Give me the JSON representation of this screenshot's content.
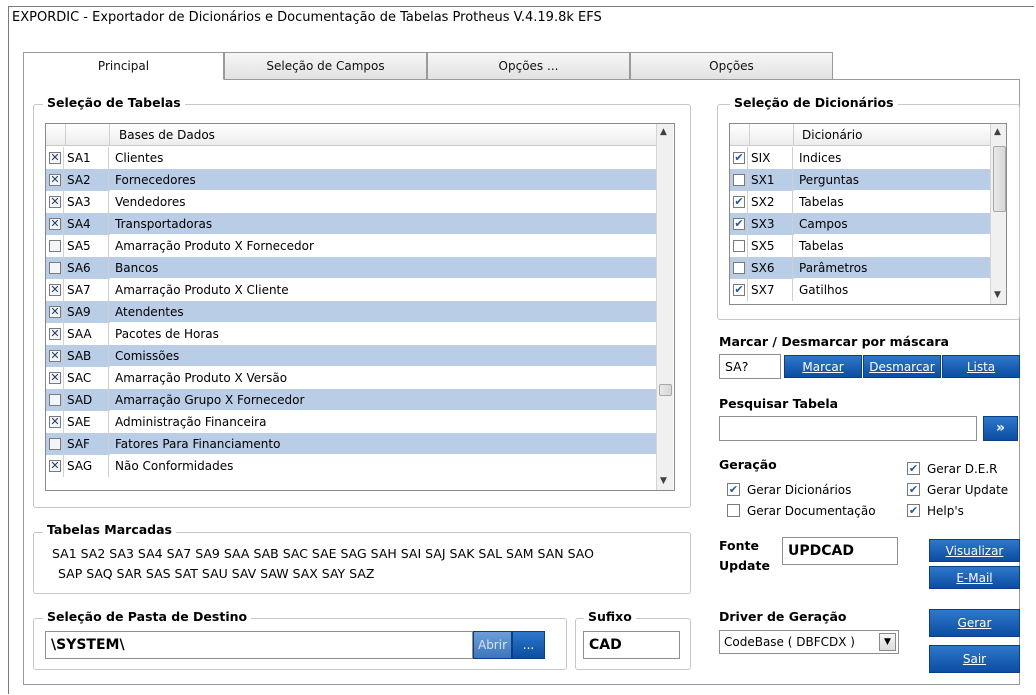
{
  "window": {
    "title": "EXPORDIC - Exportador de Dicionários e Documentação de Tabelas Protheus V.4.19.8k EFS"
  },
  "tabs": [
    {
      "label": "Principal"
    },
    {
      "label": "Seleção de Campos"
    },
    {
      "label": "Opções ..."
    },
    {
      "label": "Opções"
    }
  ],
  "tables": {
    "group_label": "Seleção de Tabelas",
    "header": "Bases de Dados",
    "rows": [
      {
        "code": "SA1",
        "name": "Clientes",
        "checked": true
      },
      {
        "code": "SA2",
        "name": "Fornecedores",
        "checked": true
      },
      {
        "code": "SA3",
        "name": "Vendedores",
        "checked": true
      },
      {
        "code": "SA4",
        "name": "Transportadoras",
        "checked": true
      },
      {
        "code": "SA5",
        "name": "Amarração Produto X Fornecedor",
        "checked": false
      },
      {
        "code": "SA6",
        "name": "Bancos",
        "checked": false
      },
      {
        "code": "SA7",
        "name": "Amarração Produto X Cliente",
        "checked": true
      },
      {
        "code": "SA9",
        "name": "Atendentes",
        "checked": true
      },
      {
        "code": "SAA",
        "name": "Pacotes de Horas",
        "checked": true
      },
      {
        "code": "SAB",
        "name": "Comissões",
        "checked": true
      },
      {
        "code": "SAC",
        "name": "Amarração Produto X Versão",
        "checked": true
      },
      {
        "code": "SAD",
        "name": "Amarração Grupo X Fornecedor",
        "checked": false
      },
      {
        "code": "SAE",
        "name": "Administração Financeira",
        "checked": true
      },
      {
        "code": "SAF",
        "name": "Fatores Para Financiamento",
        "checked": false
      },
      {
        "code": "SAG",
        "name": "Não Conformidades",
        "checked": true
      }
    ]
  },
  "dictionaries": {
    "group_label": "Seleção de Dicionários",
    "header": "Dicionário",
    "rows": [
      {
        "code": "SIX",
        "name": "Indices",
        "checked": true
      },
      {
        "code": "SX1",
        "name": "Perguntas",
        "checked": false
      },
      {
        "code": "SX2",
        "name": "Tabelas",
        "checked": true
      },
      {
        "code": "SX3",
        "name": "Campos",
        "checked": true
      },
      {
        "code": "SX5",
        "name": "Tabelas",
        "checked": false
      },
      {
        "code": "SX6",
        "name": "Parâmetros",
        "checked": false
      },
      {
        "code": "SX7",
        "name": "Gatilhos",
        "checked": true
      }
    ]
  },
  "mask": {
    "label": "Marcar / Desmarcar por máscara",
    "value": "SA?",
    "mark": "Marcar",
    "unmark": "Desmarcar",
    "list": "Lista"
  },
  "search": {
    "label": "Pesquisar Tabela",
    "value": "",
    "go": "»"
  },
  "generation": {
    "label": "Geração",
    "gen_dict": "Gerar Dicionários",
    "gen_doc": "Gerar Documentação",
    "gen_der": "Gerar D.E.R",
    "gen_update": "Gerar Update",
    "helps": "Help's",
    "gen_dict_checked": true,
    "gen_doc_checked": false,
    "gen_der_checked": true,
    "gen_update_checked": true,
    "helps_checked": true
  },
  "marked": {
    "label": "Tabelas Marcadas",
    "line1": "SA1 SA2 SA3 SA4 SA7 SA9 SAA SAB SAC SAE SAG SAH SAI SAJ SAK SAL SAM SAN SAO",
    "line2": "SAP SAQ SAR SAS SAT SAU SAV SAW SAX SAY SAZ"
  },
  "source": {
    "label_line1": "Fonte",
    "label_line2": "Update",
    "value": "UPDCAD",
    "view": "Visualizar",
    "email": "E-Mail"
  },
  "dest": {
    "label": "Seleção de Pasta de Destino",
    "value": "\\SYSTEM\\",
    "open": "Abrir",
    "browse": "..."
  },
  "suffix": {
    "label": "Sufixo",
    "value": "CAD"
  },
  "driver": {
    "label": "Driver de Geração",
    "value": "CodeBase ( DBFCDX )",
    "generate": "Gerar",
    "exit": "Sair"
  }
}
